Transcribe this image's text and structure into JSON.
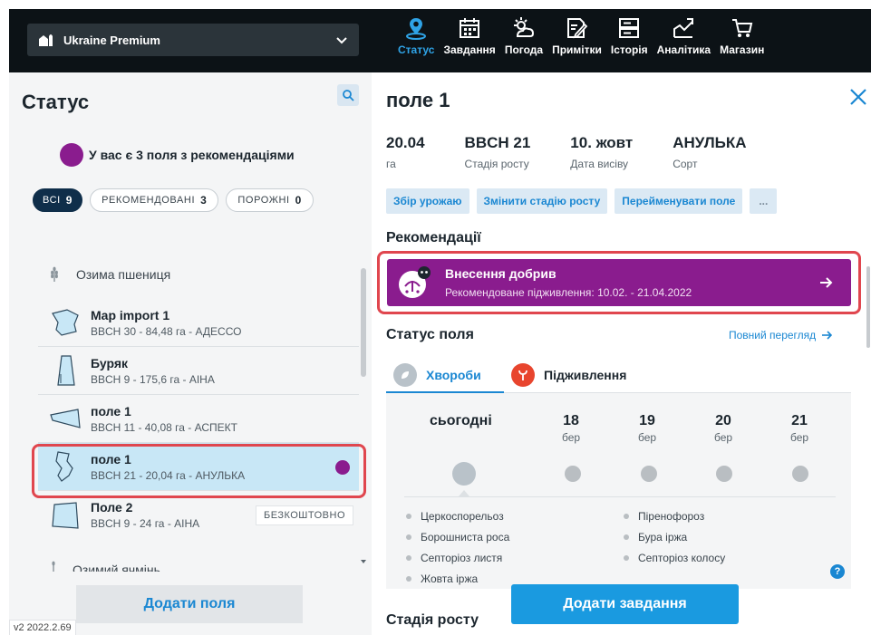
{
  "topbar": {
    "farm_name": "Ukraine Premium",
    "nav": [
      {
        "label": "Статус",
        "icon": "status-icon",
        "active": true
      },
      {
        "label": "Завдання",
        "icon": "calendar-icon"
      },
      {
        "label": "Погода",
        "icon": "weather-icon"
      },
      {
        "label": "Примітки",
        "icon": "notes-icon"
      },
      {
        "label": "Історія",
        "icon": "history-icon"
      },
      {
        "label": "Аналітика",
        "icon": "analytics-icon"
      },
      {
        "label": "Магазин",
        "icon": "cart-icon"
      }
    ]
  },
  "left": {
    "title": "Статус",
    "reco_text": "У вас є 3 поля з рекомендаціями",
    "filters": [
      {
        "label": "ВСІ",
        "count": "9"
      },
      {
        "label": "РЕКОМЕНДОВАНІ",
        "count": "3"
      },
      {
        "label": "ПОРОЖНІ",
        "count": "0"
      }
    ],
    "crop_group": "Озима пшениця",
    "fields": [
      {
        "name": "Map import 1",
        "sub": "BBCH 30 - 84,48 га - АДЕССО"
      },
      {
        "name": "Буряк",
        "sub": "BBCH 9 - 175,6 га - АІНА"
      },
      {
        "name": "поле 1",
        "sub": "BBCH 11 - 40,08 га - АСПЕКТ"
      },
      {
        "name": "поле 1",
        "sub": "BBCH 21 - 20,04 га - АНУЛЬКА"
      },
      {
        "name": "Поле 2",
        "sub": "BBCH 9 - 24 га - АІНА",
        "badge": "БЕЗКОШТОВНО"
      }
    ],
    "next_group": "Озимий ячмінь",
    "add_fields": "Додати поля",
    "version": "v2 2022.2.69"
  },
  "right": {
    "title": "поле 1",
    "stats": [
      {
        "value": "20.04",
        "label": "га"
      },
      {
        "value": "BBCH 21",
        "label": "Стадія росту"
      },
      {
        "value": "10. жовт",
        "label": "Дата висіву"
      },
      {
        "value": "АНУЛЬКА",
        "label": "Сорт"
      }
    ],
    "actions": [
      "Збір урожаю",
      "Змінити стадію росту",
      "Перейменувати поле",
      "..."
    ],
    "reco_heading": "Рекомендації",
    "reco_card": {
      "title": "Внесення добрив",
      "subtitle": "Рекомендоване підживлення: 10.02. - 21.04.2022"
    },
    "status_title": "Статус поля",
    "full_view": "Повний перегляд",
    "tabs": [
      "Хвороби",
      "Підживлення"
    ],
    "forecast": [
      {
        "day": "сьогодні",
        "month": ""
      },
      {
        "day": "18",
        "month": "бер"
      },
      {
        "day": "19",
        "month": "бер"
      },
      {
        "day": "20",
        "month": "бер"
      },
      {
        "day": "21",
        "month": "бер"
      }
    ],
    "diseases_left": [
      "Церкоспорельоз",
      "Борошниста роса",
      "Септоріоз листя",
      "Жовта іржа"
    ],
    "diseases_right": [
      "Піренофороз",
      "Бура іржа",
      "Септоріоз колосу"
    ],
    "add_task": "Додати завдання",
    "growth_title": "Стадія росту"
  },
  "colors": {
    "accent": "#1a87d2",
    "recommendation": "#8a1c8e",
    "highlight": "#e0464e",
    "topbar": "#0c1216"
  }
}
